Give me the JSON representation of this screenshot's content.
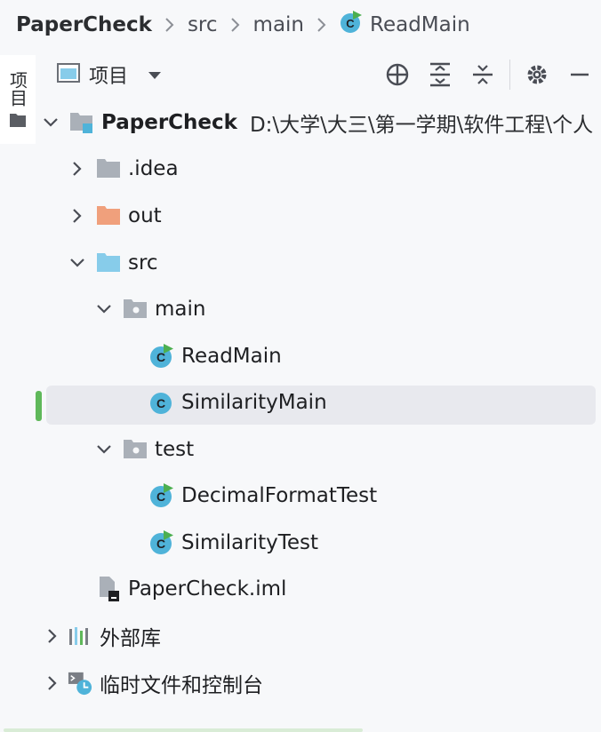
{
  "breadcrumb": {
    "root": "PaperCheck",
    "items": [
      "src",
      "main",
      "ReadMain"
    ]
  },
  "side_stripe": {
    "tab_label": "项目"
  },
  "toolbar": {
    "view_title": "项目",
    "actions": [
      "locate-icon",
      "expand-all-icon",
      "collapse-all-icon",
      "gear-icon",
      "minimize-icon"
    ]
  },
  "tree": {
    "project_name": "PaperCheck",
    "project_path": "D:\\大学\\大三\\第一学期\\软件工程\\个人",
    "idea": ".idea",
    "out": "out",
    "src": "src",
    "main": "main",
    "read_main": "ReadMain",
    "similarity_main": "SimilarityMain",
    "test": "test",
    "decimal_format_test": "DecimalFormatTest",
    "similarity_test": "SimilarityTest",
    "iml": "PaperCheck.iml",
    "external_libs": "外部库",
    "scratches": "临时文件和控制台"
  },
  "colors": {
    "accent_class": "#4fb3d9",
    "run_triangle": "#4caf50",
    "folder_gray": "#aab0b8",
    "folder_out": "#f0a07c",
    "folder_src": "#87ccea",
    "selection": "#e8e9ee",
    "change_marker": "#5fb85a"
  }
}
